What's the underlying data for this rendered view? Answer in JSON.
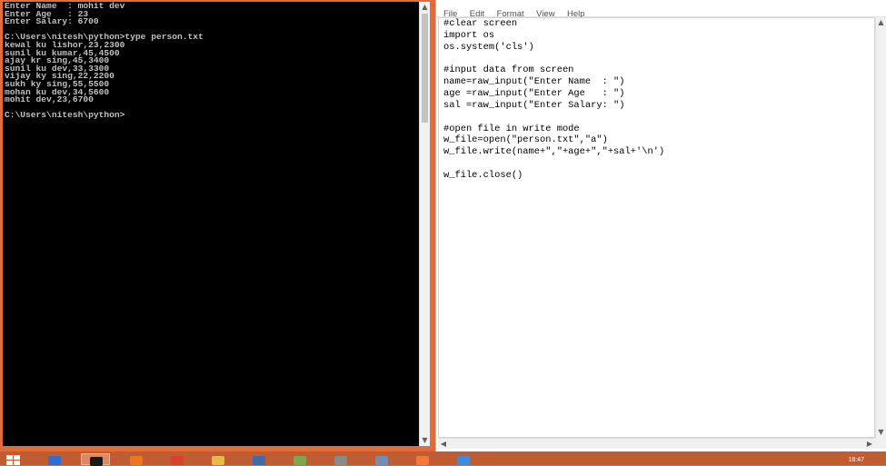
{
  "console": {
    "lines": [
      "Enter Name  : mohit dev",
      "Enter Age   : 23",
      "Enter Salary: 6700",
      "",
      "C:\\Users\\nitesh\\python>type person.txt",
      "kewal ku lishor,23,2300",
      "sunil ku kumar,45,4500",
      "ajay kr sing,45,3400",
      "sunil ku dev,33,3300",
      "vijay ky sing,22,2200",
      "sukh ky sing,55,5500",
      "mohan ku dev,34,5600",
      "mohit dev,23,6700",
      "",
      "C:\\Users\\nitesh\\python>"
    ]
  },
  "notepad": {
    "menu": [
      "File",
      "Edit",
      "Format",
      "View",
      "Help"
    ],
    "lines": [
      "#clear screen",
      "import os",
      "os.system('cls')",
      "",
      "#input data from screen",
      "name=raw_input(\"Enter Name  : \")",
      "age =raw_input(\"Enter Age   : \")",
      "sal =raw_input(\"Enter Salary: \")",
      "",
      "#open file in write mode",
      "w_file=open(\"person.txt\",\"a\")",
      "w_file.write(name+\",\"+age+\",\"+sal+'\\n')",
      "",
      "w_file.close()"
    ]
  },
  "taskbar": {
    "clock": "18:47",
    "apps": [
      {
        "icon": "monitor-icon",
        "color": "#2a6fd6"
      },
      {
        "icon": "console-icon",
        "color": "#1a1a1a",
        "active": true
      },
      {
        "icon": "firefox-icon",
        "color": "#e8791e"
      },
      {
        "icon": "chrome-icon",
        "color": "#d9412f"
      },
      {
        "icon": "folder-icon",
        "color": "#e8b84a"
      },
      {
        "icon": "app-icon",
        "color": "#3a6db0"
      },
      {
        "icon": "gallery-icon",
        "color": "#7aa84a"
      },
      {
        "icon": "tool-icon",
        "color": "#8a8a8a"
      },
      {
        "icon": "drive-icon",
        "color": "#6f8fb8"
      },
      {
        "icon": "media-icon",
        "color": "#f07a3a"
      },
      {
        "icon": "ie-icon",
        "color": "#3a8ee0"
      }
    ]
  }
}
